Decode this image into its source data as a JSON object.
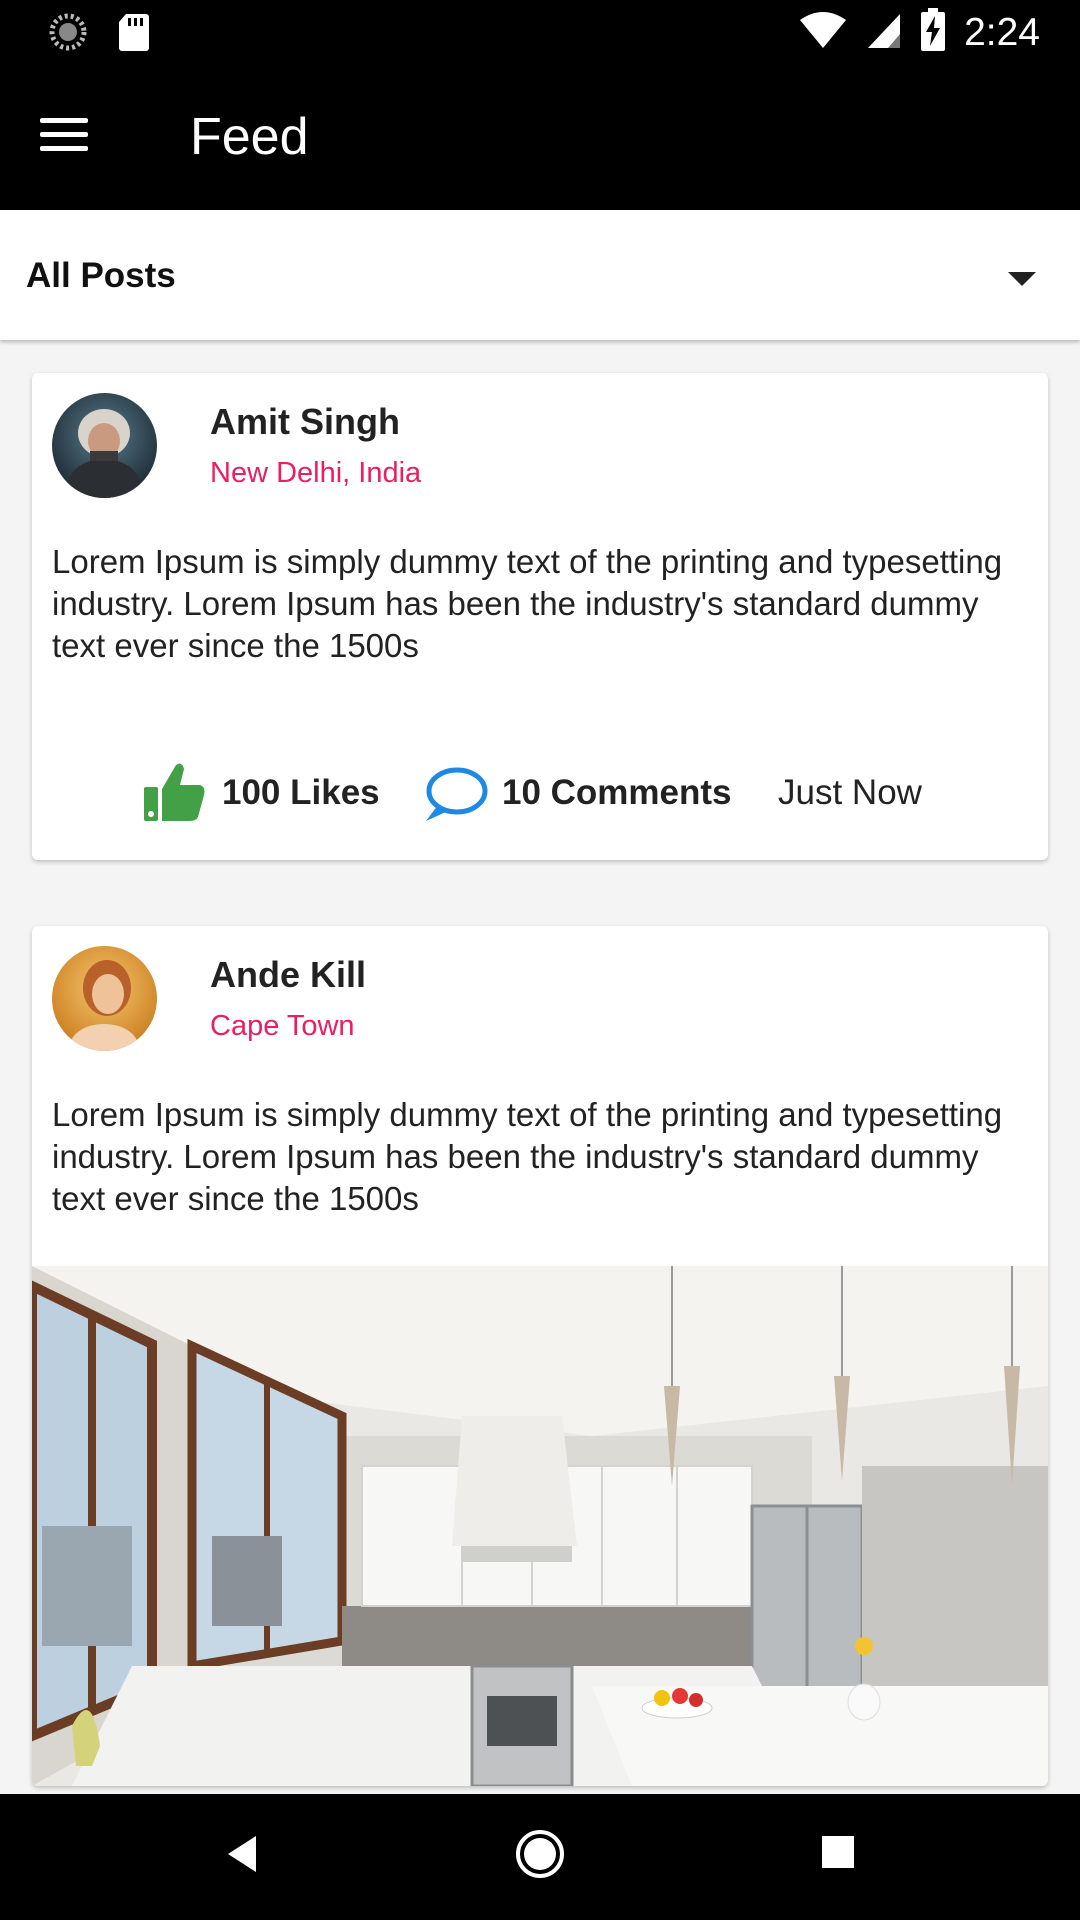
{
  "status_bar": {
    "time": "2:24"
  },
  "app_bar": {
    "title": "Feed"
  },
  "filter": {
    "selected": "All Posts"
  },
  "posts": [
    {
      "author": "Amit Singh",
      "location": "New Delhi, India",
      "body": "Lorem Ipsum is simply dummy text of the printing and typesetting industry. Lorem Ipsum has been the industry's standard dummy text ever since the 1500s",
      "likes": "100 Likes",
      "comments": "10 Comments",
      "time": "Just Now"
    },
    {
      "author": "Ande Kill",
      "location": "Cape Town",
      "body": "Lorem Ipsum is simply dummy text of the printing and typesetting industry. Lorem Ipsum has been the industry's standard dummy text ever since the 1500s"
    }
  ],
  "colors": {
    "location": "#e91e63",
    "like": "#43a047",
    "comment": "#1e88e5"
  }
}
